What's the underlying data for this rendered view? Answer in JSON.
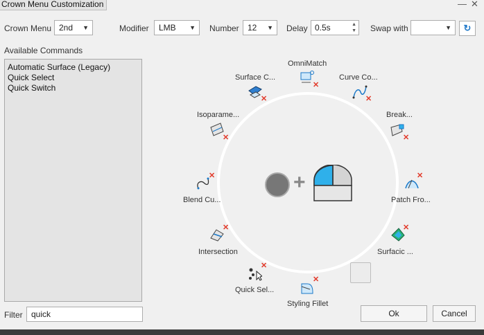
{
  "window": {
    "title": "Crown Menu Customization",
    "minimize_glyph": "—",
    "close_glyph": "✕"
  },
  "toolbar": {
    "crown_menu_label": "Crown Menu",
    "crown_menu_value": "2nd",
    "modifier_label": "Modifier",
    "modifier_value": "LMB",
    "number_label": "Number",
    "number_value": "12",
    "delay_label": "Delay",
    "delay_value": "0.5s",
    "swap_with_label": "Swap with",
    "swap_with_value": "",
    "refresh_icon": "refresh-icon"
  },
  "available": {
    "heading": "Available Commands",
    "items": [
      "Automatic Surface (Legacy)",
      "Quick Select",
      "Quick Switch"
    ]
  },
  "filter": {
    "label": "Filter",
    "value": "quick"
  },
  "crown": {
    "commands": [
      {
        "label": "OmniMatch",
        "icon": "omnimatch-icon"
      },
      {
        "label": "Curve Co...",
        "icon": "curve-connect-icon"
      },
      {
        "label": "Break...",
        "icon": "break-icon"
      },
      {
        "label": "Patch Fro...",
        "icon": "patch-from-icon"
      },
      {
        "label": "Surfacic ...",
        "icon": "surfacic-icon"
      },
      {
        "label": "Styling Fillet",
        "icon": "styling-fillet-icon"
      },
      {
        "label": "Quick Sel...",
        "icon": "quick-select-icon"
      },
      {
        "label": "Intersection",
        "icon": "intersection-icon"
      },
      {
        "label": "Blend Cu...",
        "icon": "blend-curve-icon"
      },
      {
        "label": "Isoparame...",
        "icon": "isoparametric-icon"
      },
      {
        "label": "Surface C...",
        "icon": "surface-creation-icon"
      }
    ],
    "remove_icon": "remove-x-icon",
    "center": {
      "mouse_button_icon": "circle-icon",
      "plus": "+",
      "mouse_icon": "mouse-icon"
    }
  },
  "buttons": {
    "ok": "Ok",
    "cancel": "Cancel"
  },
  "colors": {
    "accent": "#1f9fe0",
    "remove": "#e23a2a",
    "ring": "#ffffff"
  }
}
